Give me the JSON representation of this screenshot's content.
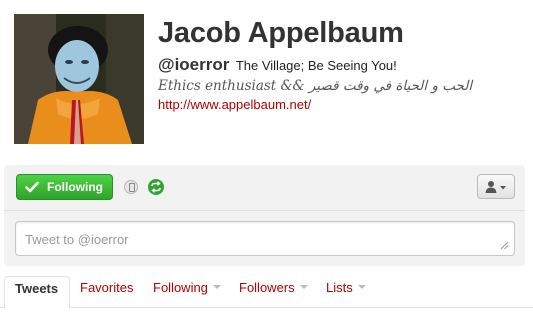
{
  "profile": {
    "name": "Jacob Appelbaum",
    "handle": "@ioerror",
    "tagline": "The Village; Be Seeing You!",
    "bio": "Ethics enthusiast && الحب و الحياة في وقت قصير",
    "url": "http://www.appelbaum.net/"
  },
  "actions": {
    "following_label": "Following",
    "tweet_placeholder": "Tweet to @ioerror"
  },
  "icons": {
    "follow": "checkmark-icon",
    "device": "device-icon",
    "retweet": "retweet-icon",
    "user_menu": "user-dropdown-icon"
  },
  "colors": {
    "link": "#b30000",
    "following_green": "#3cb933"
  },
  "tabs": [
    {
      "label": "Tweets",
      "active": true
    },
    {
      "label": "Favorites"
    },
    {
      "label": "Following"
    },
    {
      "label": "Followers"
    },
    {
      "label": "Lists"
    }
  ]
}
